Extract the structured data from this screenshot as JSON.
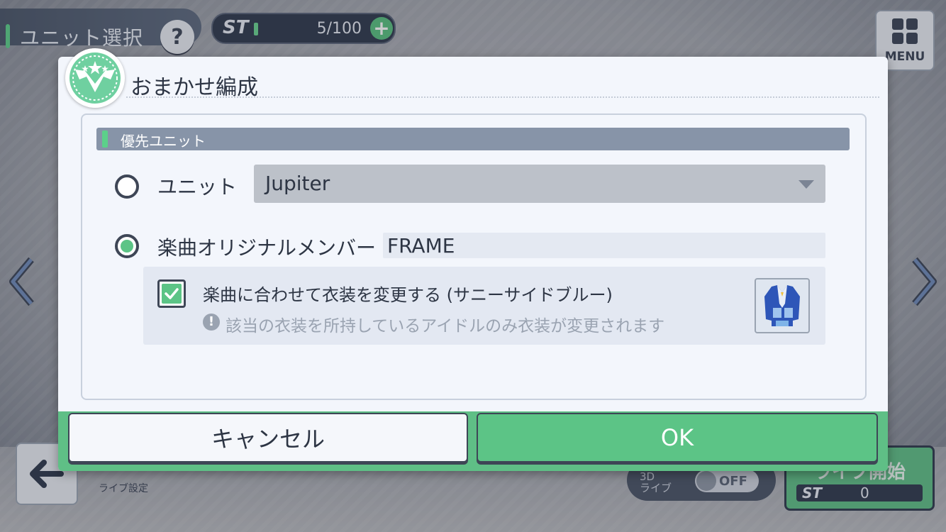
{
  "header": {
    "title": "ユニット選択",
    "help_label": "?",
    "stamina": {
      "label": "ST",
      "value": "5/100",
      "plus_label": "+",
      "fraction": 0.05
    },
    "menu_label": "MENU"
  },
  "footer": {
    "live_setting_label": "ライブ設定",
    "mode_label": "3D\nライブ",
    "toggle_label": "OFF",
    "start_label": "ライブ開始",
    "start_st_label": "ST",
    "start_st_value": "0"
  },
  "dialog": {
    "title": "おまかせ編成",
    "section_title": "優先ユニット",
    "unit_option": {
      "label": "ユニット",
      "selected": false,
      "select_value": "Jupiter"
    },
    "song_option": {
      "label": "楽曲オリジナルメンバー",
      "selected": true,
      "value": "FRAME"
    },
    "costume": {
      "checked": true,
      "label": "楽曲に合わせて衣装を変更する (サニーサイドブルー)",
      "note_icon": "!",
      "note": "該当の衣装を所持しているアイドルのみ衣装が変更されます"
    },
    "cancel_label": "キャンセル",
    "ok_label": "OK"
  },
  "colors": {
    "accent_green": "#5cc486",
    "dialog_bg": "#f3f6fc",
    "section_header": "#8794a8",
    "dark": "#2d3544"
  }
}
